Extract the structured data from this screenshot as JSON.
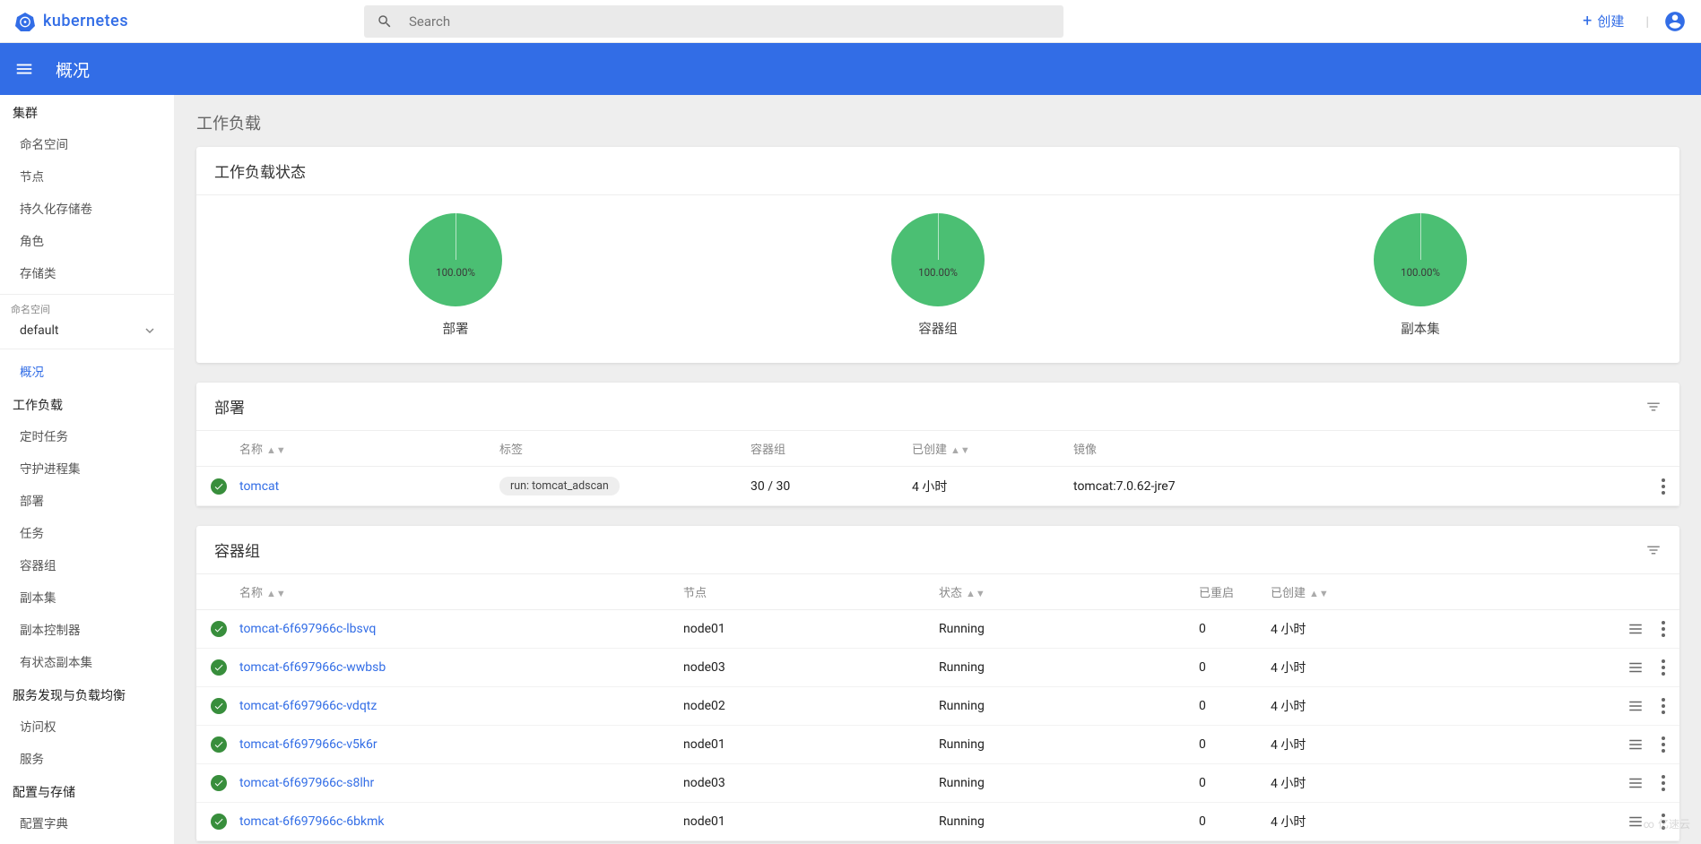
{
  "header": {
    "brand": "kubernetes",
    "search_placeholder": "Search",
    "create_label": "创建"
  },
  "subheader": {
    "title": "概况"
  },
  "sidebar": {
    "cluster_title": "集群",
    "cluster_items": [
      "命名空间",
      "节点",
      "持久化存储卷",
      "角色",
      "存储类"
    ],
    "namespace_label": "命名空间",
    "namespace_selected": "default",
    "overview": "概况",
    "workloads_title": "工作负载",
    "workloads_items": [
      "定时任务",
      "守护进程集",
      "部署",
      "任务",
      "容器组",
      "副本集",
      "副本控制器",
      "有状态副本集"
    ],
    "discovery_title": "服务发现与负载均衡",
    "discovery_items": [
      "访问权",
      "服务"
    ],
    "config_title": "配置与存储",
    "config_items": [
      "配置字典"
    ]
  },
  "content": {
    "workloads_heading": "工作负载"
  },
  "status_card": {
    "title": "工作负载状态"
  },
  "chart_data": [
    {
      "type": "pie",
      "label": "部署",
      "percent": "100.00%",
      "value": 100
    },
    {
      "type": "pie",
      "label": "容器组",
      "percent": "100.00%",
      "value": 100
    },
    {
      "type": "pie",
      "label": "副本集",
      "percent": "100.00%",
      "value": 100
    }
  ],
  "deployments": {
    "title": "部署",
    "columns": {
      "name": "名称",
      "labels": "标签",
      "pods": "容器组",
      "created": "已创建",
      "images": "镜像"
    },
    "rows": [
      {
        "name": "tomcat",
        "label": "run: tomcat_adscan",
        "pods": "30 / 30",
        "created": "4 小时",
        "image": "tomcat:7.0.62-jre7"
      }
    ]
  },
  "pods": {
    "title": "容器组",
    "columns": {
      "name": "名称",
      "node": "节点",
      "status": "状态",
      "restarts": "已重启",
      "created": "已创建"
    },
    "rows": [
      {
        "name": "tomcat-6f697966c-lbsvq",
        "node": "node01",
        "status": "Running",
        "restarts": "0",
        "created": "4 小时"
      },
      {
        "name": "tomcat-6f697966c-wwbsb",
        "node": "node03",
        "status": "Running",
        "restarts": "0",
        "created": "4 小时"
      },
      {
        "name": "tomcat-6f697966c-vdqtz",
        "node": "node02",
        "status": "Running",
        "restarts": "0",
        "created": "4 小时"
      },
      {
        "name": "tomcat-6f697966c-v5k6r",
        "node": "node01",
        "status": "Running",
        "restarts": "0",
        "created": "4 小时"
      },
      {
        "name": "tomcat-6f697966c-s8lhr",
        "node": "node03",
        "status": "Running",
        "restarts": "0",
        "created": "4 小时"
      },
      {
        "name": "tomcat-6f697966c-6bkmk",
        "node": "node01",
        "status": "Running",
        "restarts": "0",
        "created": "4 小时"
      }
    ]
  },
  "watermark": "亿速云"
}
